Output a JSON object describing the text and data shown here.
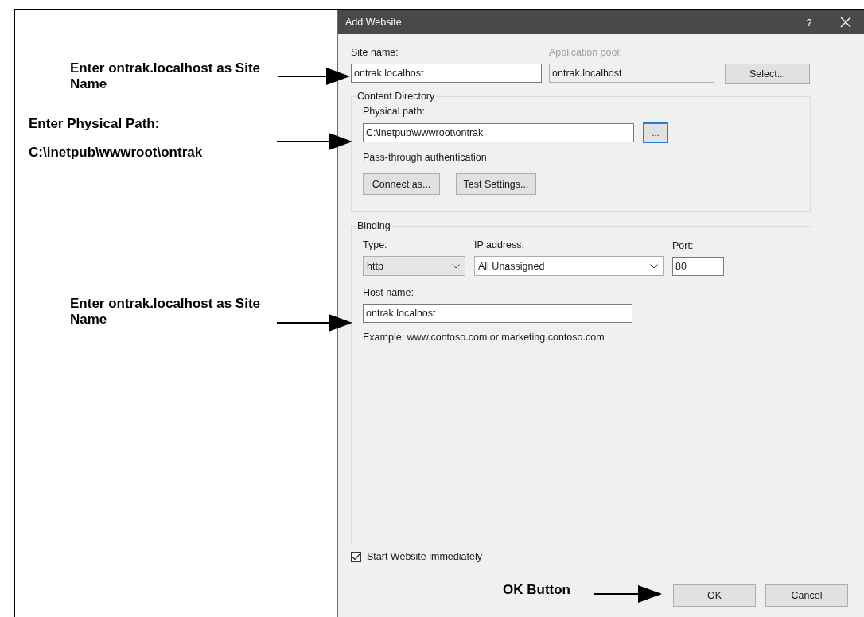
{
  "annotations": [
    {
      "lines": [
        "Enter ontrak.localhost as Site Name"
      ]
    },
    {
      "lines": [
        "Enter Physical Path:",
        "C:\\inetpub\\wwwroot\\ontrak"
      ]
    },
    {
      "lines": [
        "Enter ontrak.localhost as Site Name"
      ]
    },
    {
      "lines": [
        "OK Button"
      ]
    }
  ],
  "dialog": {
    "title": "Add Website",
    "help_button": "?",
    "site_name": {
      "label": "Site name:",
      "value": "ontrak.localhost"
    },
    "application_pool": {
      "label": "Application pool:",
      "value": "ontrak.localhost",
      "disabled": true
    },
    "select_button": "Select...",
    "content_directory": {
      "title": "Content Directory",
      "physical_path": {
        "label": "Physical path:",
        "value": "C:\\inetpub\\wwwroot\\ontrak"
      },
      "browse_button": {
        "label": "...",
        "focused": true
      },
      "authentication": "Pass-through authentication",
      "buttons": [
        "Connect as...",
        "Test Settings..."
      ]
    },
    "binding": {
      "title": "Binding",
      "type": {
        "label": "Type:",
        "value": "http",
        "kind": "list"
      },
      "ip_address": {
        "label": "IP address:",
        "value": "All Unassigned",
        "kind": "combo"
      },
      "port": {
        "label": "Port:",
        "value": "80"
      },
      "host_name": {
        "label": "Host name:",
        "value": "ontrak.localhost"
      },
      "example": "Example: www.contoso.com or marketing.contoso.com"
    },
    "start_website": {
      "label": "Start Website immediately",
      "checked": true
    },
    "buttons": [
      "OK",
      "Cancel"
    ]
  }
}
